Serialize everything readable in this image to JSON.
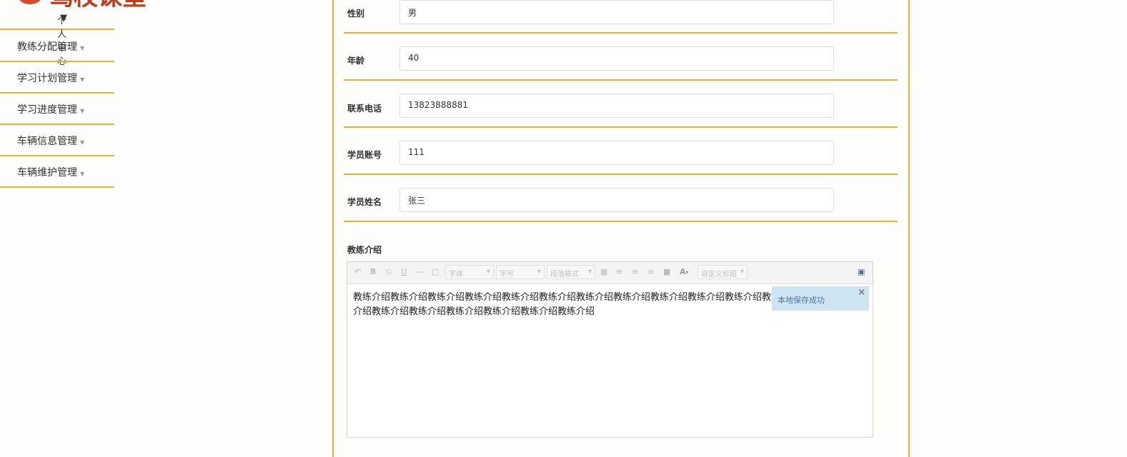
{
  "logo": {
    "text": "驾校课堂"
  },
  "sidebar": {
    "top_label": "个人中心",
    "items": [
      {
        "label": "教练分配管理"
      },
      {
        "label": "学习计划管理"
      },
      {
        "label": "学习进度管理"
      },
      {
        "label": "车辆信息管理"
      },
      {
        "label": "车辆维护管理"
      }
    ]
  },
  "form": {
    "gender": {
      "label": "性别",
      "value": "男"
    },
    "age": {
      "label": "年龄",
      "value": "40"
    },
    "phone": {
      "label": "联系电话",
      "value": "13823888881"
    },
    "student_account": {
      "label": "学员账号",
      "value": "111"
    },
    "student_name": {
      "label": "学员姓名",
      "value": "张三"
    },
    "intro_label": "教练介绍"
  },
  "editor": {
    "toolbar": {
      "bold": "B",
      "underline": "U",
      "separator": "—",
      "font_color": "A",
      "font_family": "字体",
      "font_size": "字号",
      "paragraph": "段落格式",
      "custom_title": "自定义标题"
    },
    "content": "教练介绍教练介绍教练介绍教练介绍教练介绍教练介绍教练介绍教练介绍教练介绍教练介绍教练介绍教练介绍教练介绍教练介绍教练介绍教练介绍教练介绍教练介绍",
    "toast": "本地保存成功",
    "toast_close": "×"
  },
  "colors": {
    "accent": "#f0ad2e",
    "toast_bg": "#cfe4f2"
  }
}
